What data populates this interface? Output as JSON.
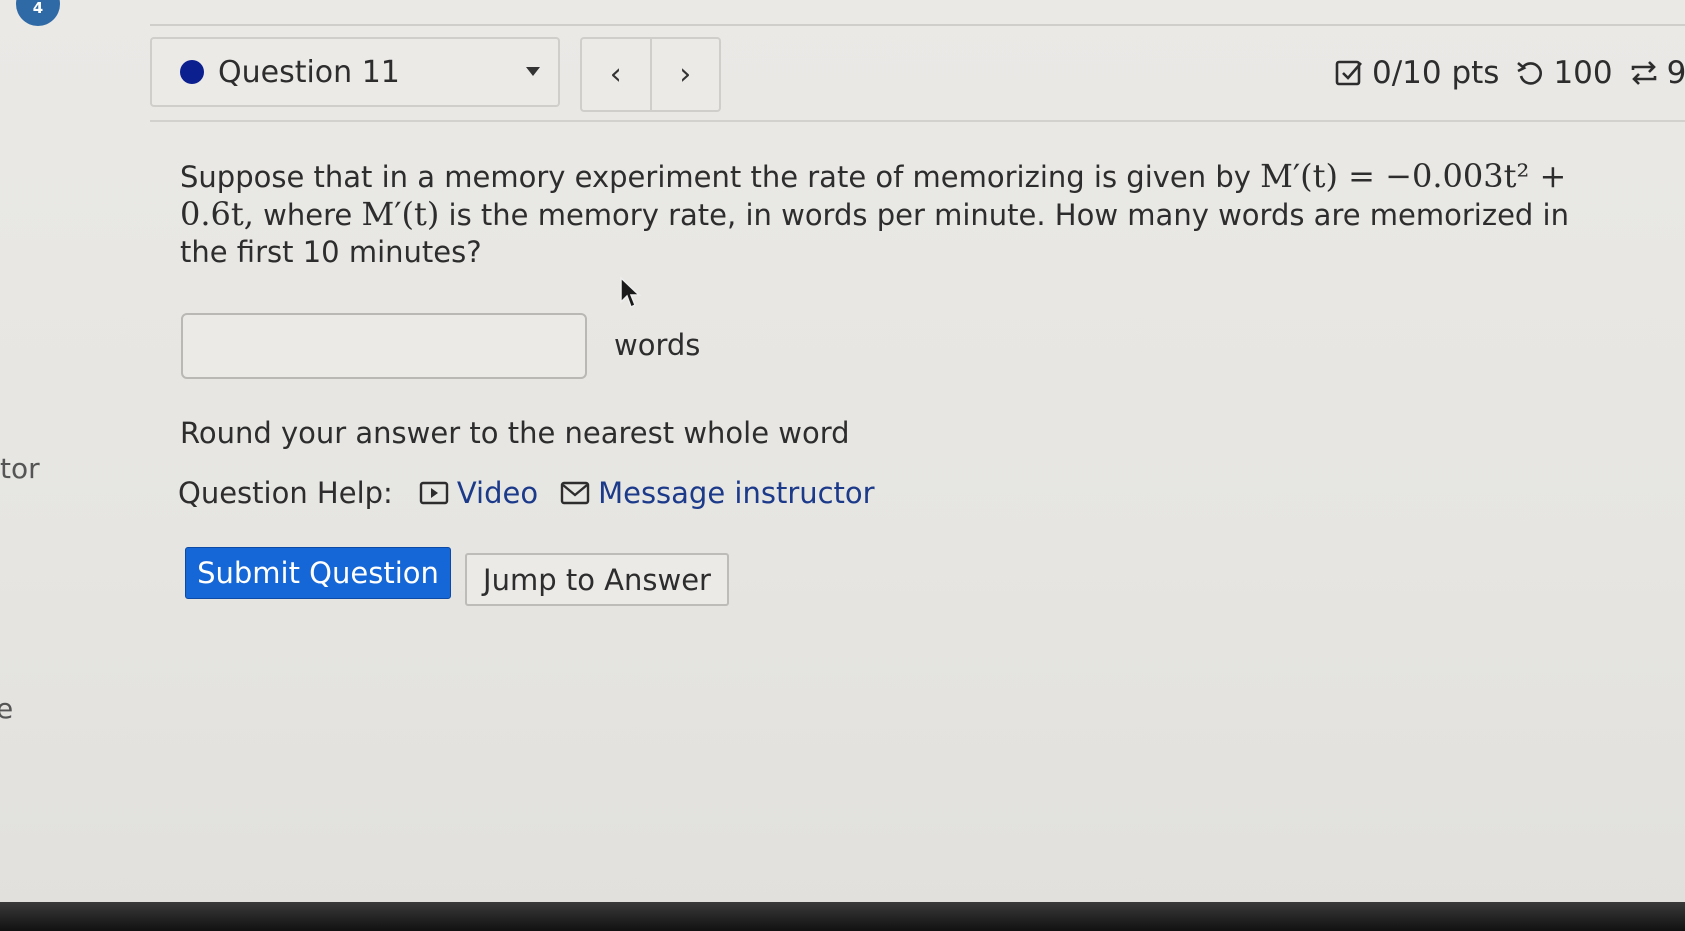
{
  "side": {
    "badge": "4",
    "fragment_1": "tor",
    "fragment_2": "e"
  },
  "header": {
    "question_label": "Question 11",
    "prev_symbol": "‹",
    "next_symbol": "›",
    "points": "0/10 pts",
    "retries": "100",
    "extra": "9"
  },
  "question": {
    "text_1": "Suppose that in a memory experiment the rate of memorizing is given by ",
    "formula": "M′(t) = −0.003t² + 0.6t,",
    "text_2": " where ",
    "symbol": "M′(t)",
    "text_3": " is the memory rate, in words per minute. How many words are memorized in the first 10 minutes?"
  },
  "answer": {
    "value": "",
    "unit": "words"
  },
  "note": "Round your answer to the nearest whole word",
  "help": {
    "label": "Question Help:",
    "video": "Video",
    "message": "Message instructor"
  },
  "buttons": {
    "submit": "Submit Question",
    "jump": "Jump to Answer"
  },
  "colors": {
    "submit_bg": "#1566d6",
    "question_dot": "#0b1f8f",
    "link": "#1c3a8a"
  },
  "icons": {
    "points": "checkbox-icon",
    "retries": "undo-icon",
    "attempts": "repeat-icon",
    "video": "play-box-icon",
    "message": "envelope-icon"
  }
}
